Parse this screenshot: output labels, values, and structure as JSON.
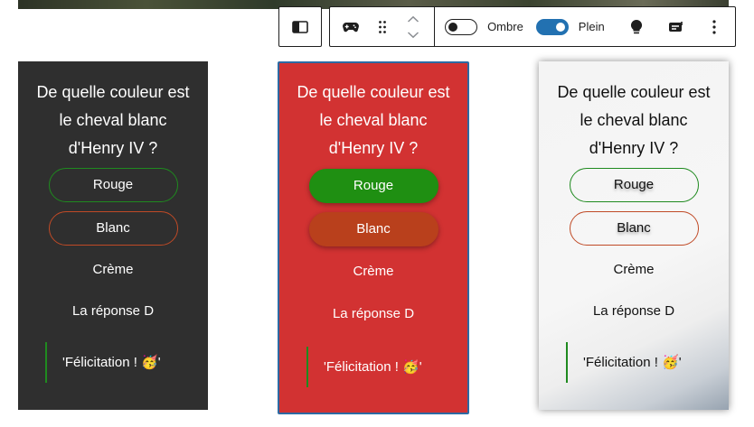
{
  "toolbar": {
    "labels": {
      "shadow": "Ombre",
      "plain": "Plein"
    },
    "toggles": {
      "shadow_on": false,
      "plain_on": true
    },
    "icons": [
      "sidebar-toggle-icon",
      "gamepad-icon",
      "drag-handle-icon",
      "move-up-icon",
      "move-down-icon",
      "lightbulb-icon",
      "block-style-icon",
      "more-options-icon"
    ]
  },
  "quiz": {
    "question": "De quelle couleur est le cheval blanc d'Henry IV ?",
    "answers": [
      "Rouge",
      "Blanc",
      "Crème",
      "La réponse D"
    ],
    "feedback": "'Félicitation ! 🥳'"
  },
  "colors": {
    "dark_card": "#2f2f2f",
    "red_card": "#d23232",
    "correct": "#1f8f12",
    "wrong": "#b9401c",
    "selection_border": "#2d6aa3",
    "toggle_on": "#2271b1"
  }
}
